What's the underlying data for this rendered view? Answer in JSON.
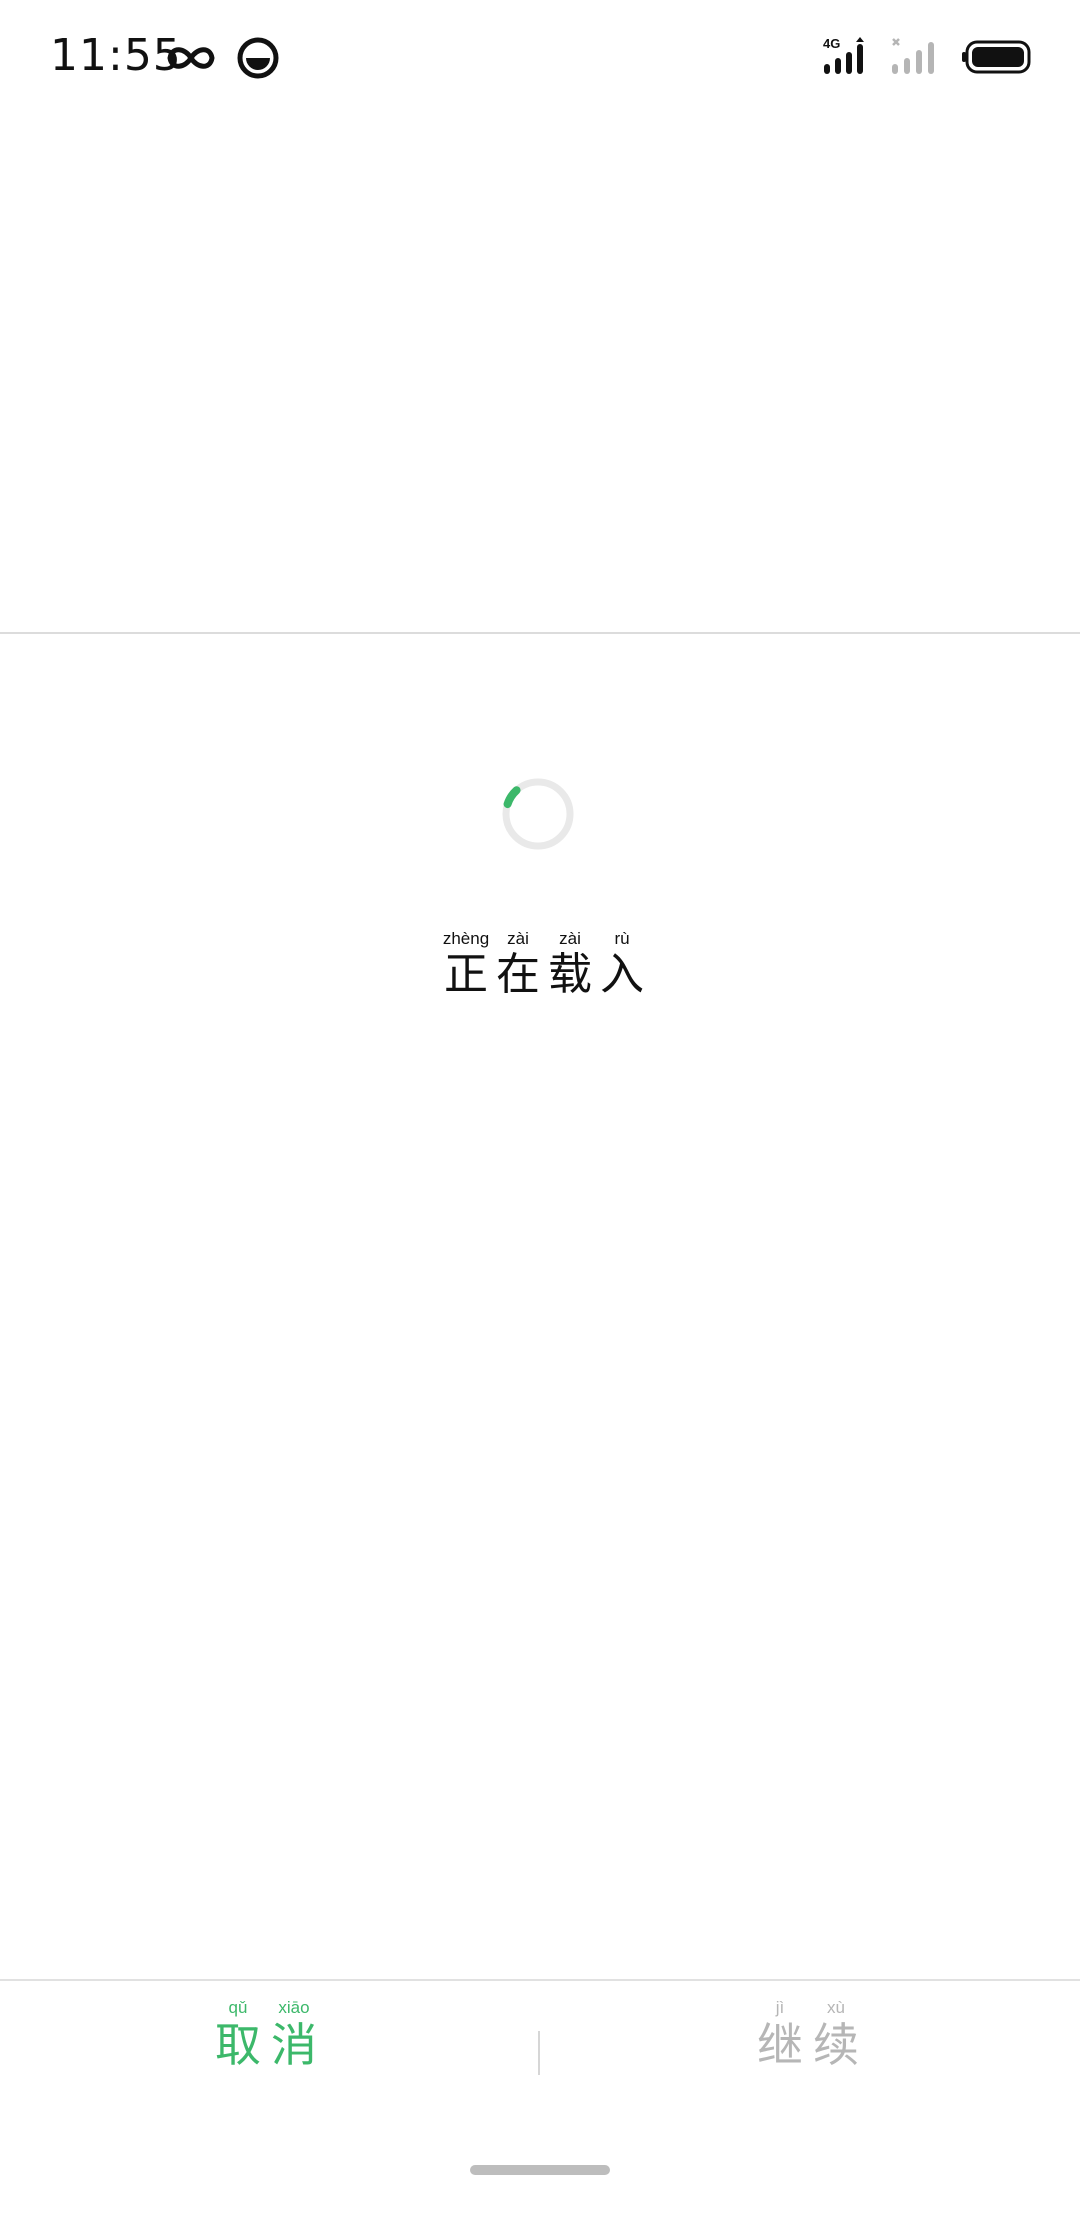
{
  "status_bar": {
    "time": "11:55",
    "network": "4G",
    "icons": [
      "infinity-icon",
      "app-notification-icon",
      "signal-4g-icon",
      "signal-no-sim-icon",
      "battery-icon"
    ]
  },
  "loading": {
    "characters": [
      {
        "pinyin": "zhèng",
        "hanzi": "正"
      },
      {
        "pinyin": "zài",
        "hanzi": "在"
      },
      {
        "pinyin": "zài",
        "hanzi": "载"
      },
      {
        "pinyin": "rù",
        "hanzi": "入"
      }
    ],
    "spinner_color": "#3cb86a"
  },
  "actions": {
    "cancel": {
      "characters": [
        {
          "pinyin": "qǔ",
          "hanzi": "取"
        },
        {
          "pinyin": "xiāo",
          "hanzi": "消"
        }
      ],
      "color": "#3cb86a"
    },
    "continue": {
      "characters": [
        {
          "pinyin": "jì",
          "hanzi": "继"
        },
        {
          "pinyin": "xù",
          "hanzi": "续"
        }
      ],
      "color": "#b6b6b6"
    }
  }
}
